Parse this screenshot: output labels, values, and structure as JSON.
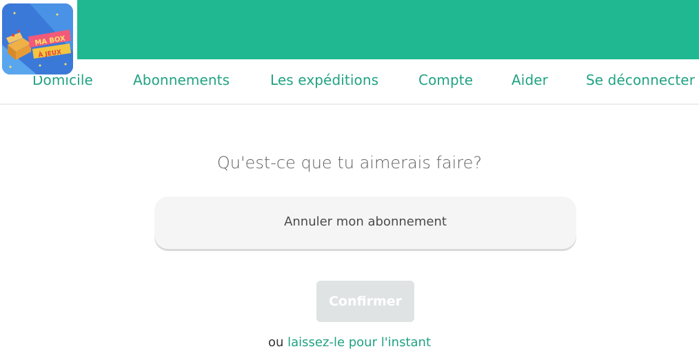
{
  "brand": {
    "logo_line1": "MA BOX",
    "logo_line2": "À JEUX",
    "primary_color": "#20b890",
    "link_color": "#20a283"
  },
  "nav": {
    "items": [
      {
        "label": "Domicile"
      },
      {
        "label": "Abonnements"
      },
      {
        "label": "Les expéditions"
      },
      {
        "label": "Compte"
      },
      {
        "label": "Aider"
      },
      {
        "label": "Se déconnecter"
      }
    ]
  },
  "main": {
    "question": "Qu'est-ce que tu aimerais faire?",
    "option_label": "Annuler mon abonnement",
    "confirm_label": "Confirmer",
    "footer_prefix": "ou",
    "footer_link": "laissez-le pour l'instant"
  }
}
